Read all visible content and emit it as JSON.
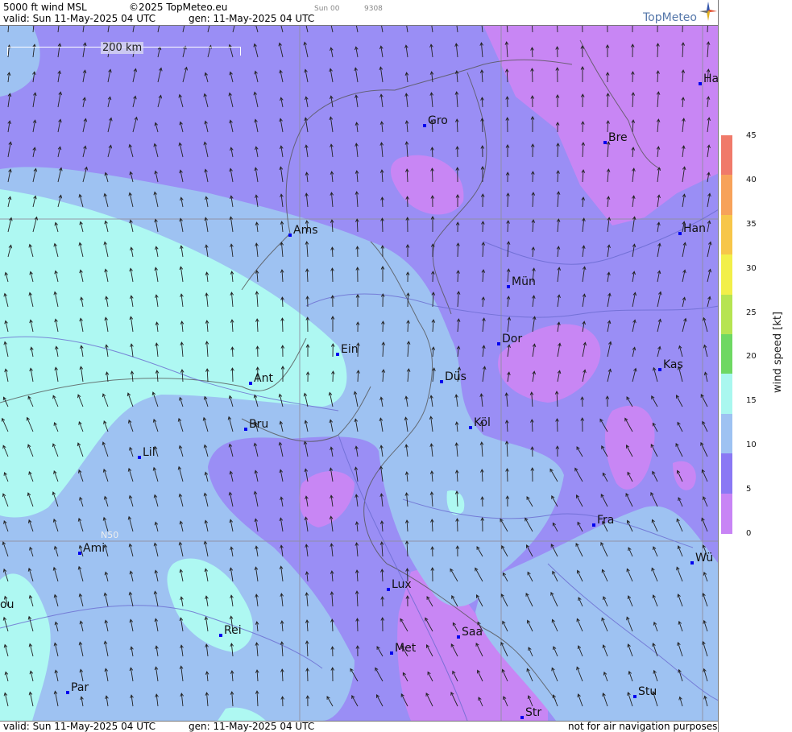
{
  "header": {
    "title": "5000 ft wind MSL",
    "copyright": "©2025 TopMeteo.eu",
    "run_label": "Sun 00",
    "code": "9308",
    "valid": "valid:  Sun  11-May-2025  04 UTC",
    "gen": "gen: 11-May-2025 04 UTC"
  },
  "logo": {
    "text": "TopMeteo"
  },
  "scale": {
    "label": "200 km"
  },
  "grid_label": "N50",
  "cities": [
    {
      "name": "Ha"
    },
    {
      "name": "Gro"
    },
    {
      "name": "Bre"
    },
    {
      "name": "Ams"
    },
    {
      "name": "Han"
    },
    {
      "name": "Mün"
    },
    {
      "name": "Ein"
    },
    {
      "name": "Dor"
    },
    {
      "name": "Ant"
    },
    {
      "name": "Düs"
    },
    {
      "name": "Kas"
    },
    {
      "name": "Bru"
    },
    {
      "name": "Köl"
    },
    {
      "name": "Lil"
    },
    {
      "name": "Fra"
    },
    {
      "name": "Ami"
    },
    {
      "name": "Wü"
    },
    {
      "name": "Lux"
    },
    {
      "name": "ou"
    },
    {
      "name": "Rei"
    },
    {
      "name": "Saa"
    },
    {
      "name": "Met"
    },
    {
      "name": "Par"
    },
    {
      "name": "Stu"
    },
    {
      "name": "Str"
    }
  ],
  "legend": {
    "title": "wind  speed  [kt]",
    "ticks": [
      "45",
      "40",
      "35",
      "30",
      "25",
      "20",
      "15",
      "10",
      "5",
      "0"
    ],
    "colors": [
      "#f07a6a",
      "#f7a25a",
      "#f7c64a",
      "#f2ef4a",
      "#b6e452",
      "#6ed863",
      "#a9f7ef",
      "#9ec2f2",
      "#8a78f4",
      "#c884f5"
    ]
  },
  "footer": {
    "valid": "valid:  Sun  11-May-2025  04 UTC",
    "gen": "gen: 11-May-2025 04 UTC",
    "note": "not for air navigation purposes"
  }
}
